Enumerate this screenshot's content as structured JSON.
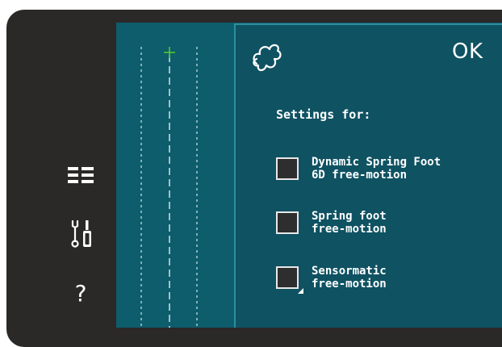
{
  "sidebar": {
    "items": [
      {
        "icon": "list-icon"
      },
      {
        "icon": "tools-icon"
      },
      {
        "icon": "help-icon",
        "label": "?"
      }
    ]
  },
  "dialog": {
    "ok_label": "OK",
    "settings_label": "Settings for:",
    "options": [
      {
        "line1": "Dynamic Spring Foot",
        "line2": "6D free-motion",
        "checked": false
      },
      {
        "line1": "Spring foot",
        "line2": "free-motion",
        "checked": false
      },
      {
        "line1": "Sensormatic",
        "line2": "free-motion",
        "checked": false
      }
    ]
  }
}
